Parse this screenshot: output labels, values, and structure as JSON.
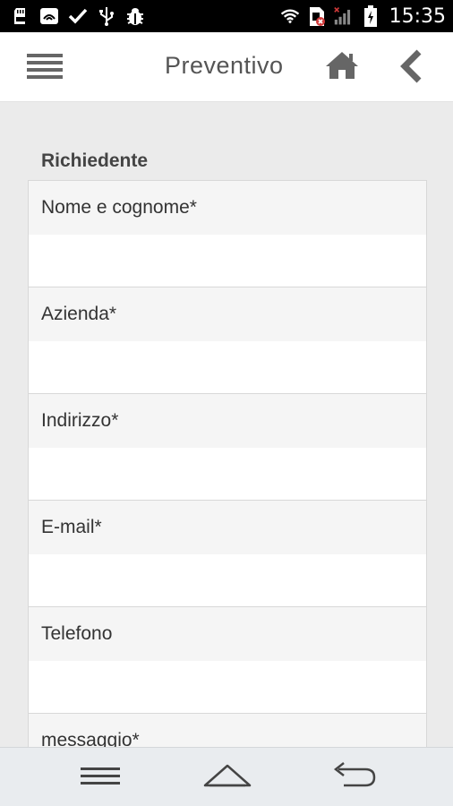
{
  "status_bar": {
    "time": "15:35",
    "left_icons": [
      "sd-card-icon",
      "screen-cast-icon",
      "check-icon",
      "usb-icon",
      "bug-icon"
    ],
    "right_icons": [
      "wifi-icon",
      "no-sim-icon",
      "signal-icon",
      "battery-charging-icon"
    ]
  },
  "header": {
    "title": "Preventivo",
    "menu_icon": "hamburger-menu-icon",
    "home_icon": "home-icon",
    "back_icon": "chevron-left-icon"
  },
  "form": {
    "section_title": "Richiedente",
    "fields": [
      {
        "label": "Nome e cognome*",
        "value": ""
      },
      {
        "label": "Azienda*",
        "value": ""
      },
      {
        "label": "Indirizzo*",
        "value": ""
      },
      {
        "label": "E-mail*",
        "value": ""
      },
      {
        "label": "Telefono",
        "value": ""
      },
      {
        "label": "messaggio*",
        "value": ""
      }
    ]
  },
  "nav_bar": {
    "buttons": [
      "menu-icon",
      "home-icon",
      "back-icon"
    ]
  },
  "colors": {
    "status_bar_bg": "#000000",
    "header_bg": "#ffffff",
    "page_bg": "#ebebeb",
    "field_label_bg": "#f5f5f5",
    "nav_bar_bg": "#e9ecef",
    "icon_gray": "#666666"
  }
}
